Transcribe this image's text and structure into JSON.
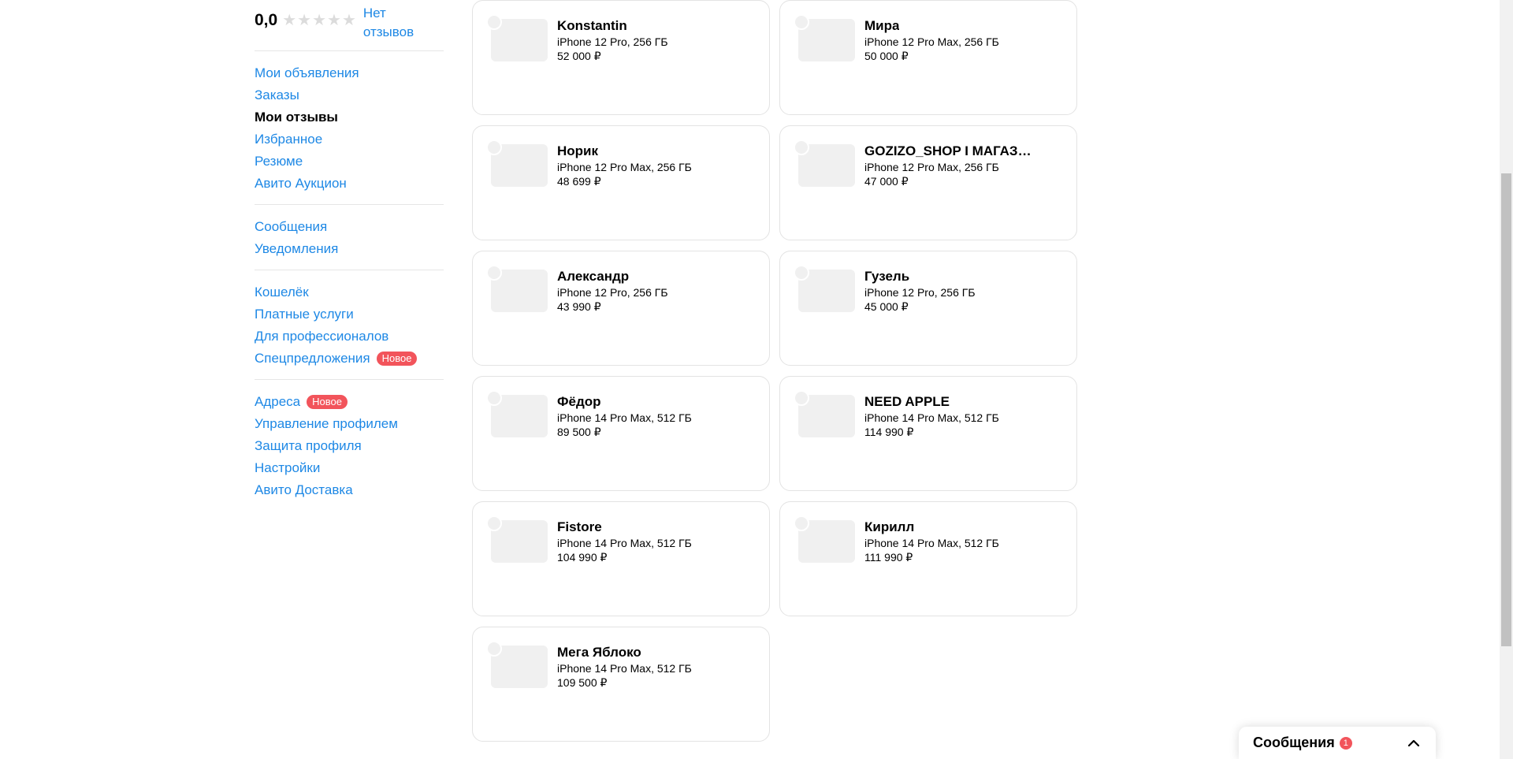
{
  "sidebar": {
    "rating": "0,0",
    "stars": 0,
    "no_reviews": "Нет отзывов",
    "groups": [
      [
        {
          "label": "Мои объявления"
        },
        {
          "label": "Заказы"
        },
        {
          "label": "Мои отзывы",
          "active": true
        },
        {
          "label": "Избранное"
        },
        {
          "label": "Резюме"
        },
        {
          "label": "Авито Аукцион"
        }
      ],
      [
        {
          "label": "Сообщения"
        },
        {
          "label": "Уведомления"
        }
      ],
      [
        {
          "label": "Кошелёк"
        },
        {
          "label": "Платные услуги"
        },
        {
          "label": "Для профессионалов"
        },
        {
          "label": "Спецпредложения",
          "badge": "Новое"
        }
      ],
      [
        {
          "label": "Адреса",
          "badge": "Новое"
        },
        {
          "label": "Управление профилем"
        },
        {
          "label": "Защита профиля"
        },
        {
          "label": "Настройки"
        },
        {
          "label": "Авито Доставка"
        }
      ]
    ]
  },
  "cards": [
    {
      "name": "Konstantin",
      "product": "iPhone 12 Pro, 256 ГБ",
      "price": "52 000 ₽"
    },
    {
      "name": "Мира",
      "product": "iPhone 12 Pro Max, 256 ГБ",
      "price": "50 000 ₽"
    },
    {
      "name": "Норик",
      "product": "iPhone 12 Pro Max, 256 ГБ",
      "price": "48 699 ₽"
    },
    {
      "name": "GOZIZO_SHOP I МАГАЗИН...",
      "product": "iPhone 12 Pro Max, 256 ГБ",
      "price": "47 000 ₽"
    },
    {
      "name": "Александр",
      "product": "iPhone 12 Pro, 256 ГБ",
      "price": "43 990 ₽"
    },
    {
      "name": "Гузель",
      "product": "iPhone 12 Pro, 256 ГБ",
      "price": "45 000 ₽"
    },
    {
      "name": "Фёдор",
      "product": "iPhone 14 Pro Max, 512 ГБ",
      "price": "89 500 ₽"
    },
    {
      "name": "NEED APPLE",
      "product": "iPhone 14 Pro Max, 512 ГБ",
      "price": "114 990 ₽"
    },
    {
      "name": "Fistore",
      "product": "iPhone 14 Pro Max, 512 ГБ",
      "price": "104 990 ₽"
    },
    {
      "name": "Кирилл",
      "product": "iPhone 14 Pro Max, 512 ГБ",
      "price": "111 990 ₽"
    },
    {
      "name": "Мега Яблоко",
      "product": "iPhone 14 Pro Max, 512 ГБ",
      "price": "109 500 ₽"
    }
  ],
  "messages_widget": {
    "title": "Сообщения",
    "count": "1",
    "chevron_icon": "chevron-up-icon"
  },
  "colors": {
    "link": "#1e88e5",
    "badge": "#f2545b",
    "border": "#e3e3e3"
  }
}
